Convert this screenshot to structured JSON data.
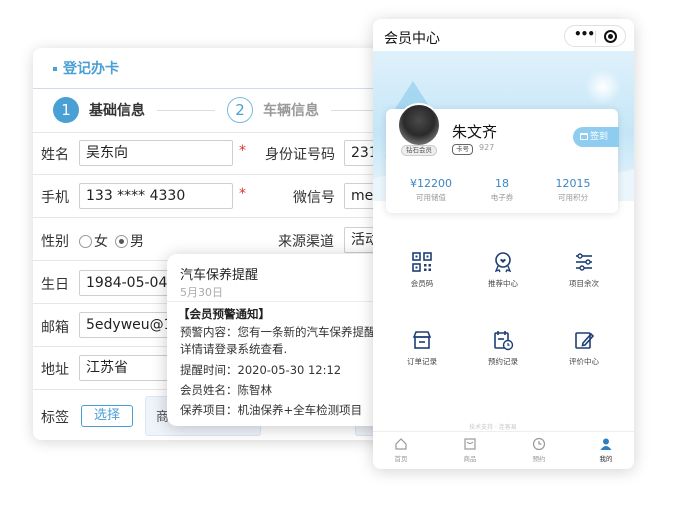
{
  "registration": {
    "title": "登记办卡",
    "steps": [
      {
        "num": "1",
        "label": "基础信息"
      },
      {
        "num": "2",
        "label": "车辆信息"
      }
    ],
    "required_mark": "*",
    "fields": {
      "name": {
        "label": "姓名",
        "value": "吴东向"
      },
      "id_number": {
        "label": "身份证号码",
        "value": "231"
      },
      "phone": {
        "label": "手机",
        "value": "133 **** 4330"
      },
      "wechat": {
        "label": "微信号",
        "value": "mel"
      },
      "gender": {
        "label": "性别",
        "options": [
          "女",
          "男"
        ],
        "selected": "男"
      },
      "source": {
        "label": "来源渠道",
        "value": "活动"
      },
      "birthday": {
        "label": "生日",
        "value": "1984-05-04"
      },
      "email": {
        "label": "邮箱",
        "value": "5edyweu@16"
      },
      "address": {
        "label": "地址",
        "value": "江苏省"
      },
      "tags": {
        "label": "标签",
        "button": "选择",
        "chip": "商"
      }
    }
  },
  "notification": {
    "title": "汽车保养提醒",
    "date": "5月30日",
    "heading": "【会员预警通知】",
    "content_line1": "预警内容：您有一条新的汽车保养提醒，",
    "content_line2": "详情请登录系统查看.",
    "remind_time": "提醒时间：2020-05-30 12:12",
    "member_name": "会员姓名：陈智林",
    "service_items": "保养项目：机油保养+全车检测项目"
  },
  "member_center": {
    "title": "会员中心",
    "capsule": {
      "more": "•••"
    },
    "profile": {
      "name": "朱文齐",
      "level_badge": "钻石会员",
      "card_tag": "卡号",
      "card_no": "927",
      "signin": "签到"
    },
    "stats": [
      {
        "value": "¥12200",
        "label": "可用储值"
      },
      {
        "value": "18",
        "label": "电子券"
      },
      {
        "value": "12015",
        "label": "可用积分"
      }
    ],
    "grid": [
      {
        "label": "会员码",
        "icon": "qrcode-icon"
      },
      {
        "label": "推荐中心",
        "icon": "recommend-icon"
      },
      {
        "label": "项目余次",
        "icon": "list-settings-icon"
      },
      {
        "label": "订单记录",
        "icon": "shop-order-icon"
      },
      {
        "label": "预约记录",
        "icon": "calendar-clock-icon"
      },
      {
        "label": "评价中心",
        "icon": "edit-review-icon"
      }
    ],
    "faint_text": "技术支持 · 连客易",
    "tabs": [
      {
        "label": "首页",
        "icon": "home-icon"
      },
      {
        "label": "商品",
        "icon": "goods-icon"
      },
      {
        "label": "预约",
        "icon": "clock-icon"
      },
      {
        "label": "我的",
        "icon": "user-icon",
        "active": true
      }
    ]
  },
  "colors": {
    "accent": "#4a9fd4",
    "required": "#e03333",
    "stat_value": "#3b86c5"
  }
}
